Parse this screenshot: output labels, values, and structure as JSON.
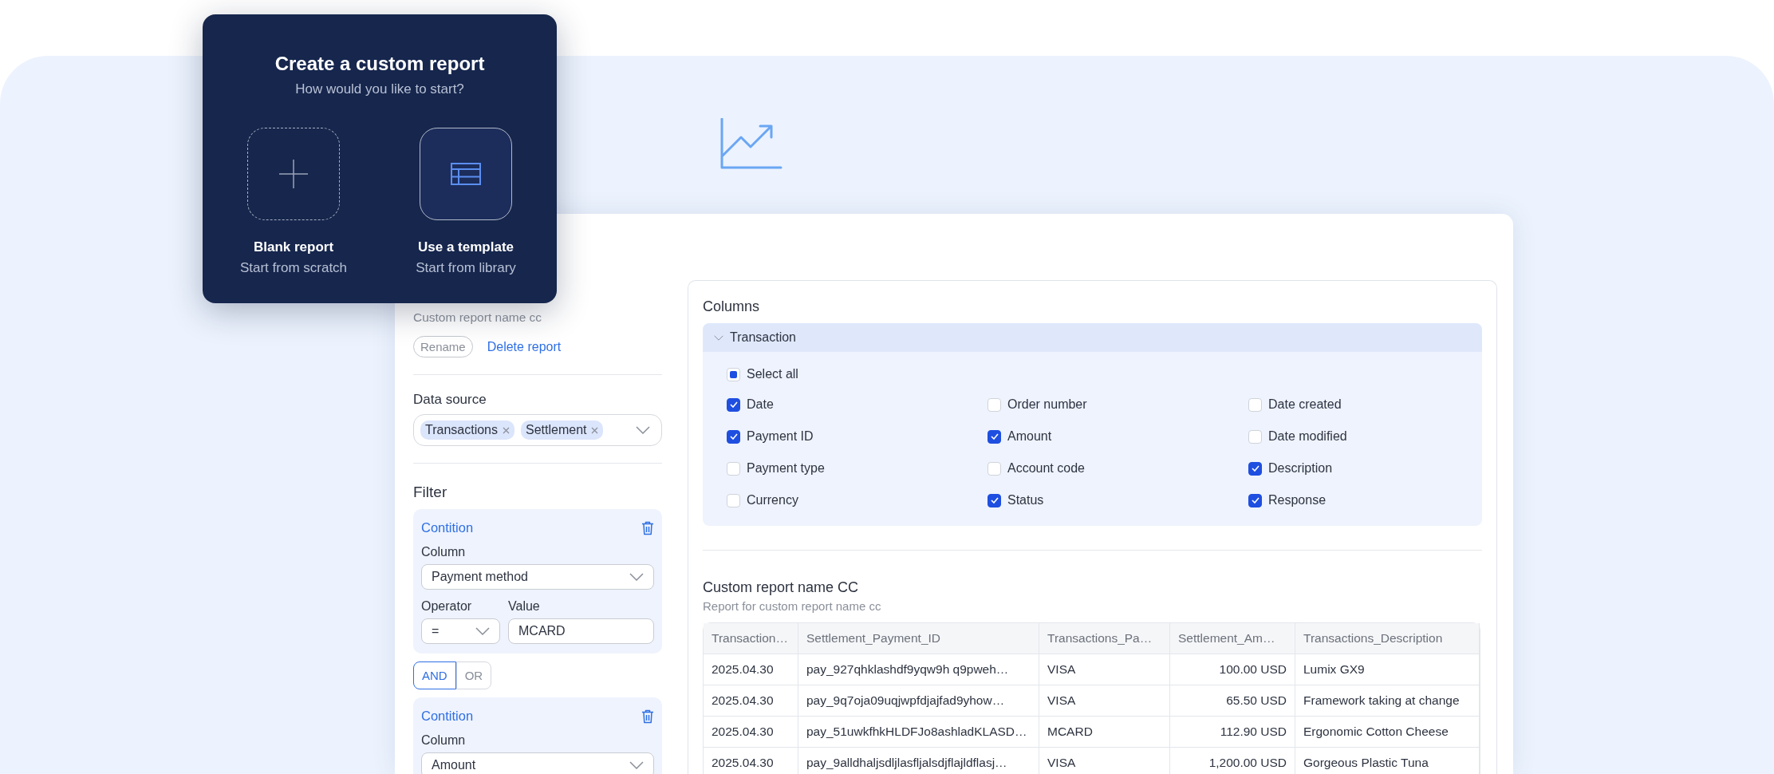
{
  "popup": {
    "title": "Create a custom report",
    "subtitle": "How would you like to start?",
    "options": [
      {
        "kind": "blank",
        "label": "Blank report",
        "caption": "Start from scratch"
      },
      {
        "kind": "template",
        "label": "Use a template",
        "caption": "Start from library"
      }
    ]
  },
  "sidebar": {
    "report_name": "Custom report name cc",
    "rename_button": "Rename",
    "delete_link": "Delete report",
    "data_source": {
      "label": "Data source",
      "tags": [
        "Transactions",
        "Settlement"
      ]
    },
    "filter": {
      "title": "Filter",
      "blocks": [
        {
          "kind": "condition",
          "title": "Contition",
          "column_label": "Column",
          "column_value": "Payment method",
          "operator_label": "Operator",
          "operator_value": "=",
          "value_label": "Value",
          "value": "MCARD"
        },
        {
          "kind": "logic",
          "options": [
            {
              "label": "AND",
              "selected": true
            },
            {
              "label": "OR",
              "selected": false
            }
          ]
        },
        {
          "kind": "condition",
          "title": "Contition",
          "column_label": "Column",
          "column_value": "Amount"
        }
      ]
    }
  },
  "columns_panel": {
    "title": "Columns",
    "group": {
      "label": "Transaction",
      "expanded": true,
      "select_all": {
        "label": "Select all",
        "indeterminate": true,
        "checked": false
      },
      "items": [
        {
          "label": "Date",
          "checked": true
        },
        {
          "label": "Order number",
          "checked": false
        },
        {
          "label": "Date created",
          "checked": false
        },
        {
          "label": "Payment ID",
          "checked": true
        },
        {
          "label": "Amount",
          "checked": true
        },
        {
          "label": "Date modified",
          "checked": false
        },
        {
          "label": "Payment type",
          "checked": false
        },
        {
          "label": "Account code",
          "checked": false
        },
        {
          "label": "Description",
          "checked": true
        },
        {
          "label": "Currency",
          "checked": false
        },
        {
          "label": "Status",
          "checked": true
        },
        {
          "label": "Response",
          "checked": true
        }
      ]
    }
  },
  "report": {
    "title": "Custom report name CC",
    "subtitle": "Report for custom report name cc",
    "table": {
      "columns": [
        {
          "label": "Transaction…",
          "kind": "text"
        },
        {
          "label": "Settlement_Payment_ID",
          "kind": "text"
        },
        {
          "label": "Transactions_Pa…",
          "kind": "text"
        },
        {
          "label": "Settlement_Am…",
          "kind": "amount"
        },
        {
          "label": "Transactions_Description",
          "kind": "text"
        }
      ],
      "rows": [
        [
          "2025.04.30",
          "pay_927qhklashdf9yqw9h q9pweh…",
          "VISA",
          "100.00 USD",
          "Lumix GX9"
        ],
        [
          "2025.04.30",
          "pay_9q7oja09uqjwpfdjajfad9yhow…",
          "VISA",
          "65.50 USD",
          "Framework taking at change"
        ],
        [
          "2025.04.30",
          "pay_51uwkfhkHLDFJo8ashladKLASD…",
          "MCARD",
          "112.90 USD",
          "Ergonomic Cotton Cheese"
        ],
        [
          "2025.04.30",
          "pay_9alldhaljsdljlasfljalsdjflajldflasj…",
          "VISA",
          "1,200.00 USD",
          "Gorgeous Plastic Tuna"
        ]
      ]
    }
  }
}
